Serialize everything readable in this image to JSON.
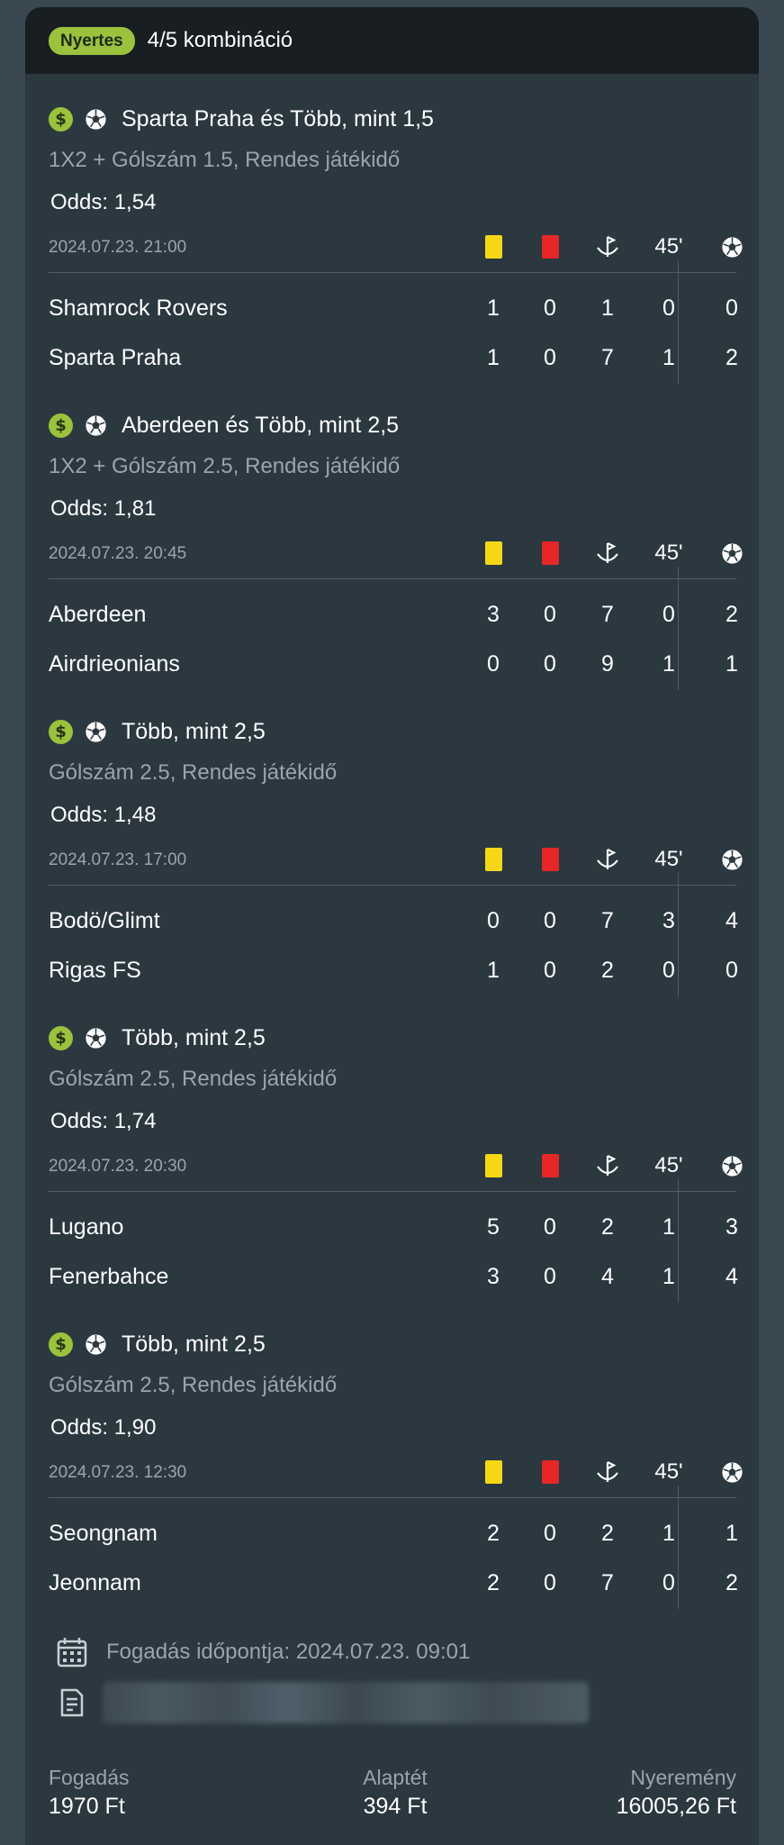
{
  "header": {
    "status_badge": "Nyertes",
    "title": "4/5 kombináció"
  },
  "columns": {
    "half_time": "45'"
  },
  "bets": [
    {
      "title": "Sparta Praha és Több, mint 1,5",
      "market": "1X2 + Gólszám 1.5, Rendes játékidő",
      "odds": "Odds: 1,54",
      "datetime": "2024.07.23.  21:00",
      "teams": [
        {
          "name": "Shamrock Rovers",
          "yellow": "1",
          "red": "0",
          "corners": "1",
          "ht": "0",
          "goals": "0"
        },
        {
          "name": "Sparta Praha",
          "yellow": "1",
          "red": "0",
          "corners": "7",
          "ht": "1",
          "goals": "2"
        }
      ]
    },
    {
      "title": "Aberdeen és Több, mint 2,5",
      "market": "1X2 + Gólszám 2.5, Rendes játékidő",
      "odds": "Odds: 1,81",
      "datetime": "2024.07.23.  20:45",
      "teams": [
        {
          "name": "Aberdeen",
          "yellow": "3",
          "red": "0",
          "corners": "7",
          "ht": "0",
          "goals": "2"
        },
        {
          "name": "Airdrieonians",
          "yellow": "0",
          "red": "0",
          "corners": "9",
          "ht": "1",
          "goals": "1"
        }
      ]
    },
    {
      "title": "Több, mint 2,5",
      "market": "Gólszám 2.5, Rendes játékidő",
      "odds": "Odds: 1,48",
      "datetime": "2024.07.23.  17:00",
      "teams": [
        {
          "name": "Bodö/Glimt",
          "yellow": "0",
          "red": "0",
          "corners": "7",
          "ht": "3",
          "goals": "4"
        },
        {
          "name": "Rigas FS",
          "yellow": "1",
          "red": "0",
          "corners": "2",
          "ht": "0",
          "goals": "0"
        }
      ]
    },
    {
      "title": "Több, mint 2,5",
      "market": "Gólszám 2.5, Rendes játékidő",
      "odds": "Odds: 1,74",
      "datetime": "2024.07.23.  20:30",
      "teams": [
        {
          "name": "Lugano",
          "yellow": "5",
          "red": "0",
          "corners": "2",
          "ht": "1",
          "goals": "3"
        },
        {
          "name": "Fenerbahce",
          "yellow": "3",
          "red": "0",
          "corners": "4",
          "ht": "1",
          "goals": "4"
        }
      ]
    },
    {
      "title": "Több, mint 2,5",
      "market": "Gólszám 2.5, Rendes játékidő",
      "odds": "Odds: 1,90",
      "datetime": "2024.07.23.  12:30",
      "teams": [
        {
          "name": "Seongnam",
          "yellow": "2",
          "red": "0",
          "corners": "2",
          "ht": "1",
          "goals": "1"
        },
        {
          "name": "Jeonnam",
          "yellow": "2",
          "red": "0",
          "corners": "7",
          "ht": "0",
          "goals": "2"
        }
      ]
    }
  ],
  "bet_time": "Fogadás időpontja:  2024.07.23.  09:01",
  "footer": {
    "stake_label": "Fogadás",
    "stake_value": "1970 Ft",
    "base_label": "Alaptét",
    "base_value": "394 Ft",
    "win_label": "Nyeremény",
    "win_value": "16005,26 Ft"
  },
  "colors": {
    "accent_green": "#9ac23c",
    "yellow_card": "#f5d716",
    "red_card": "#e52727",
    "header_bg": "#181e22",
    "card_bg": "#2b3840"
  }
}
